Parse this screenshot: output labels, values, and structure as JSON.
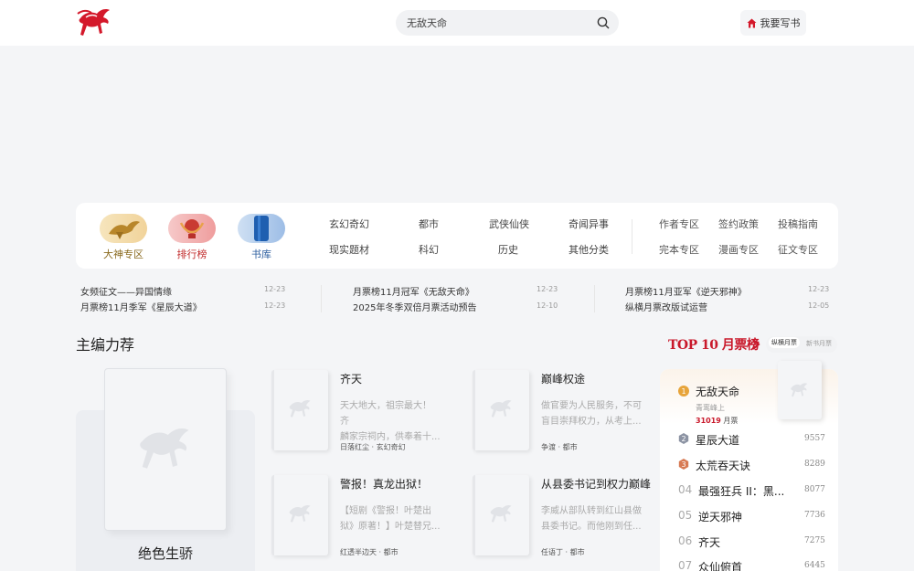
{
  "header": {
    "search_value": "无敌天命",
    "write_label": "我要写书"
  },
  "nav": {
    "zones": [
      {
        "label": "大神专区",
        "icon": "eagle-icon"
      },
      {
        "label": "排行榜",
        "icon": "trophy-icon"
      },
      {
        "label": "书库",
        "icon": "books-icon"
      }
    ],
    "categories": [
      "玄幻奇幻",
      "都市",
      "武侠仙侠",
      "奇闻异事",
      "现实题材",
      "科幻",
      "历史",
      "其他分类"
    ],
    "extras": [
      "作者专区",
      "签约政策",
      "投稿指南",
      "完本专区",
      "漫画专区",
      "征文专区"
    ]
  },
  "news": [
    {
      "title": "女频征文——异国情缘",
      "date": "12-23"
    },
    {
      "title": "月票榜11月季军《星辰大道》",
      "date": "12-23"
    },
    {
      "title": "月票榜11月冠军《无敌天命》",
      "date": "12-23"
    },
    {
      "title": "2025年冬季双倍月票活动预告",
      "date": "12-10"
    },
    {
      "title": "月票榜11月亚军《逆天邪神》",
      "date": "12-23"
    },
    {
      "title": "纵横月票改版试运营",
      "date": "12-05"
    }
  ],
  "recommend": {
    "title": "主编力荐",
    "featured_title": "绝色生骄",
    "books": [
      {
        "title": "齐天",
        "desc1": "天大地大，祖宗最大！ 齐",
        "desc2": "麟家宗祠内，供奉着十...",
        "meta": "日落红尘 · 玄幻奇幻"
      },
      {
        "title": "巅峰权途",
        "desc1": "做官要为人民服务，不可",
        "desc2": "盲目崇拜权力，从考上...",
        "meta": "争渡 · 都市"
      },
      {
        "title": "警报！真龙出狱！",
        "desc1": "【短剧《警报！叶楚出",
        "desc2": "狱》原著！】叶楚替兄...",
        "meta": "红透半边天 · 都市"
      },
      {
        "title": "从县委书记到权力巅峰",
        "desc1": "李威从部队转到红山县做",
        "desc2": "县委书记。而他刚到任...",
        "meta": "任语丁 · 都市"
      }
    ]
  },
  "ranking": {
    "title": "TOP 10 月票榜",
    "tabs": [
      "纵横月票",
      "新书月票"
    ],
    "first": {
      "num": "1",
      "title": "无敌天命",
      "author": "青鸾峰上",
      "votes": "31019",
      "votes_unit": "月票"
    },
    "items": [
      {
        "num": "2",
        "title": "星辰大道",
        "votes": "9557"
      },
      {
        "num": "3",
        "title": "太荒吞天诀",
        "votes": "8289"
      },
      {
        "num": "04",
        "title": "最强狂兵 II：黑...",
        "votes": "8077"
      },
      {
        "num": "05",
        "title": "逆天邪神",
        "votes": "7736"
      },
      {
        "num": "06",
        "title": "齐天",
        "votes": "7275"
      },
      {
        "num": "07",
        "title": "众仙俯首",
        "votes": "6445"
      }
    ]
  },
  "colors": {
    "accent": "#c9192b",
    "gold": "#e7a43a",
    "silver": "#8c93a3",
    "bronze": "#d77a53"
  }
}
